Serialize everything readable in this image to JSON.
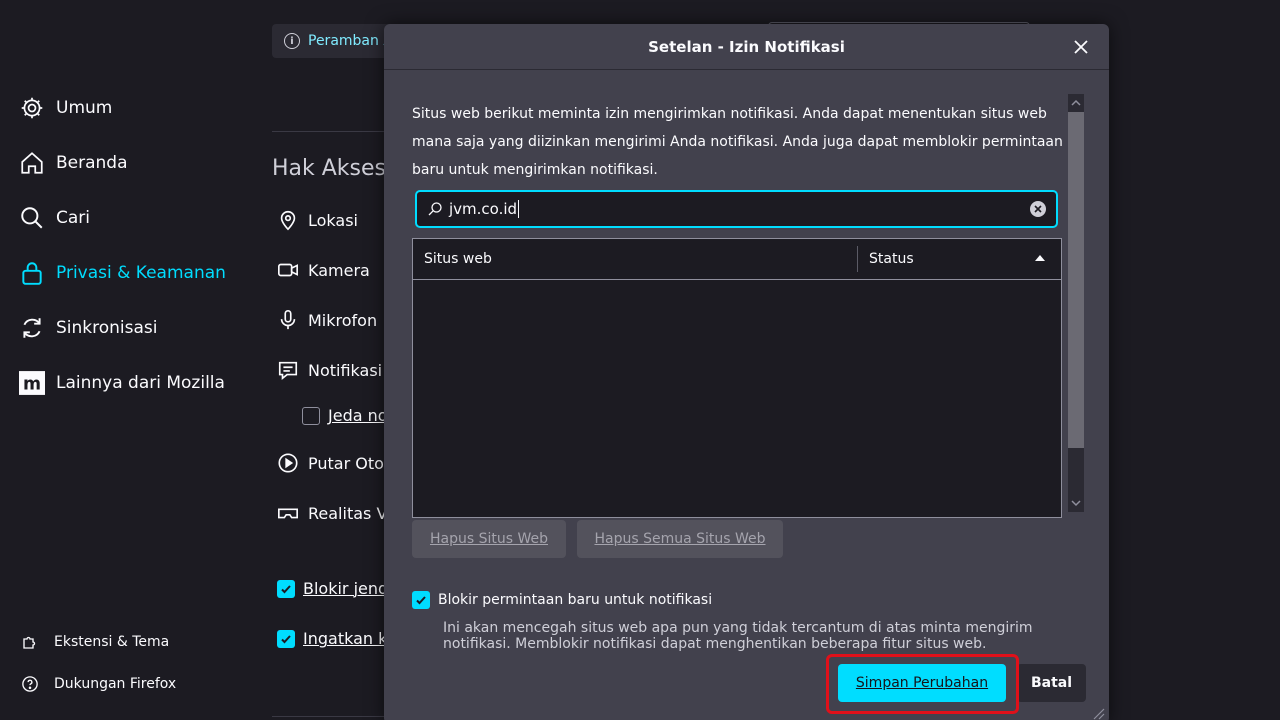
{
  "background": {
    "info_text": "Peramban A",
    "sidebar": {
      "items": [
        {
          "label": "Umum",
          "icon": "gear-icon"
        },
        {
          "label": "Beranda",
          "icon": "home-icon"
        },
        {
          "label": "Cari",
          "icon": "search-icon"
        },
        {
          "label": "Privasi & Keamanan",
          "icon": "lock-icon",
          "active": true
        },
        {
          "label": "Sinkronisasi",
          "icon": "sync-icon"
        },
        {
          "label": "Lainnya dari Mozilla",
          "icon": "mozilla-icon"
        }
      ],
      "footer": [
        {
          "label": "Ekstensi & Tema",
          "icon": "puzzle-icon"
        },
        {
          "label": "Dukungan Firefox",
          "icon": "help-icon"
        }
      ]
    },
    "permissions_heading": "Hak Akses",
    "permissions": [
      {
        "label": "Lokasi",
        "icon": "location-icon"
      },
      {
        "label": "Kamera",
        "icon": "camera-icon"
      },
      {
        "label": "Mikrofon",
        "icon": "microphone-icon"
      },
      {
        "label": "Notifikasi",
        "icon": "notification-icon"
      },
      {
        "label": "Putar Otom",
        "icon": "autoplay-icon"
      },
      {
        "label": "Realitas Vi",
        "icon": "vr-icon"
      }
    ],
    "pause_label": "Jeda no",
    "block_popups_label": "Blokir jend",
    "warn_addons_label": "Ingatkan ke"
  },
  "dialog": {
    "title": "Setelan - Izin Notifikasi",
    "description": "Situs web berikut meminta izin mengirimkan notifikasi. Anda dapat menentukan situs web mana saja yang diizinkan mengirimi Anda notifikasi. Anda juga dapat memblokir permintaan baru untuk mengirimkan notifikasi.",
    "search_value": "jvm.co.id",
    "columns": [
      "Situs web",
      "Status"
    ],
    "remove_site_label": "Hapus Situs Web",
    "remove_all_label": "Hapus Semua Situs Web",
    "block_new_label": "Blokir permintaan baru untuk notifikasi",
    "block_new_checked": true,
    "block_note": "Ini akan mencegah situs web apa pun yang tidak tercantum di atas minta mengirim notifikasi. Memblokir notifikasi dapat menghentikan beberapa fitur situs web.",
    "save_label": "Simpan Perubahan",
    "cancel_label": "Batal"
  },
  "colors": {
    "accent": "#00ddff",
    "highlight_border": "#e0101a",
    "dialog_bg": "#42414d",
    "page_bg": "#1c1b22"
  }
}
